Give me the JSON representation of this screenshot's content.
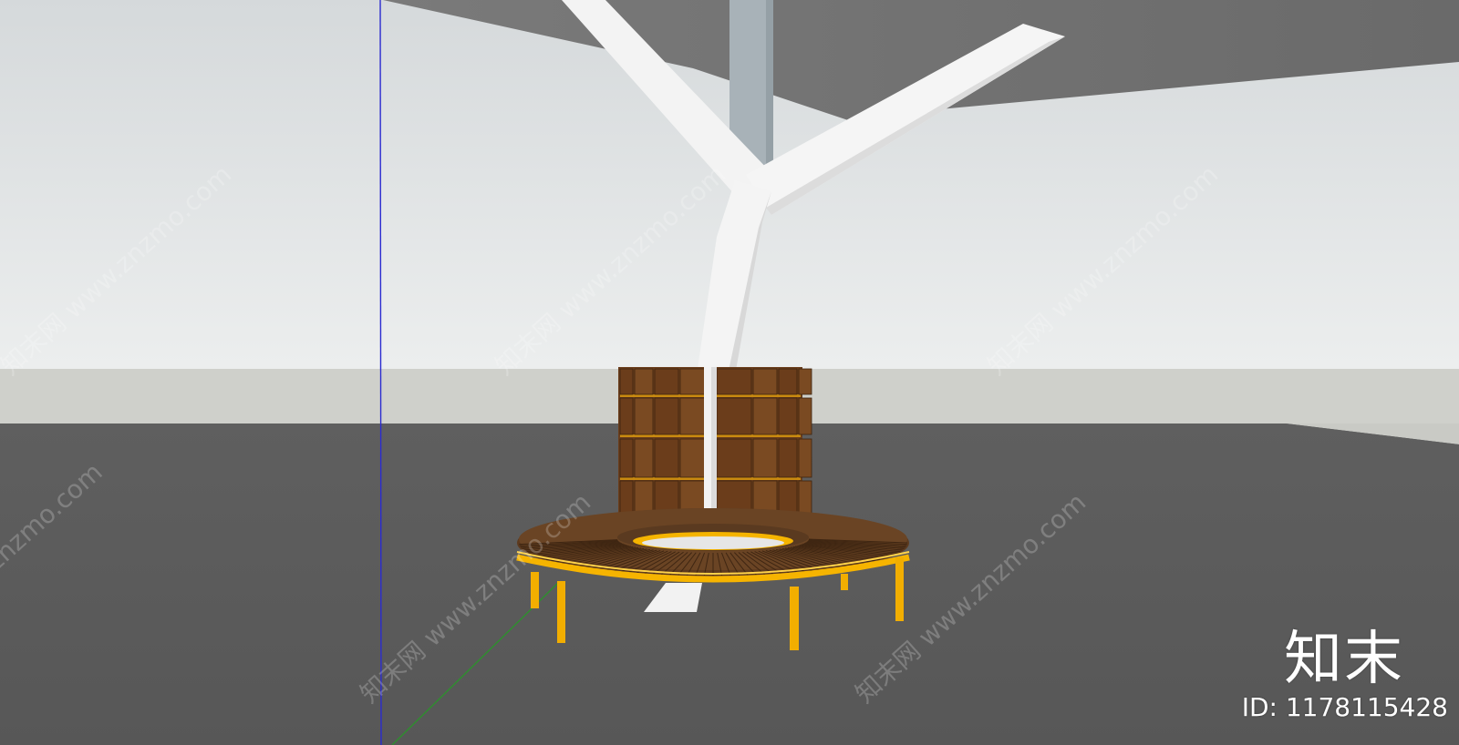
{
  "scene": {
    "sky_top_color": "#d6dadc",
    "sky_bottom_color": "#e9ebec",
    "ceiling_color": "#6f6f6f",
    "wall_color": "#cfd0cc",
    "floor_color": "#5c5c5c",
    "branch_color": "#f4f4f4",
    "column_color": "#a9b3b8",
    "bench_frame_color": "#f5b400",
    "wood_color": "#6a3f1f",
    "axis_blue": "#3333cc",
    "axis_green": "#2e8b2e"
  },
  "watermarks": {
    "text": "知末网 www.znzmo.com",
    "short": "znzmo.com"
  },
  "brand": {
    "name": "知末",
    "id_label": "ID: 1178115428"
  }
}
